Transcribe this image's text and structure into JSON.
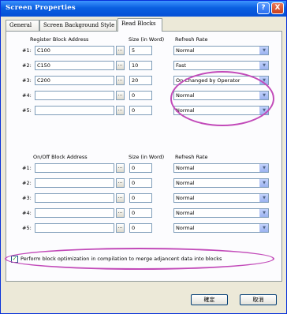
{
  "window": {
    "title": "Screen Properties",
    "help_label": "?",
    "close_label": "X"
  },
  "tabs": [
    {
      "label": "General"
    },
    {
      "label": "Screen Background Style"
    },
    {
      "label": "Read Blocks"
    }
  ],
  "register": {
    "header_address": "Register Block Address",
    "header_size": "Size (in Word)",
    "header_rate": "Refresh Rate",
    "rows": [
      {
        "label": "#1:",
        "address": "C100",
        "size": "5",
        "rate": "Normal"
      },
      {
        "label": "#2:",
        "address": "C150",
        "size": "10",
        "rate": "Fast"
      },
      {
        "label": "#3:",
        "address": "C200",
        "size": "20",
        "rate": "On Changed by Operator"
      },
      {
        "label": "#4:",
        "address": "",
        "size": "0",
        "rate": "Normal"
      },
      {
        "label": "#5:",
        "address": "",
        "size": "0",
        "rate": "Normal"
      }
    ]
  },
  "onoff": {
    "header_address": "On/Off Block Address",
    "header_size": "Size (in Word)",
    "header_rate": "Refresh Rate",
    "rows": [
      {
        "label": "#1:",
        "address": "",
        "size": "0",
        "rate": "Normal"
      },
      {
        "label": "#2:",
        "address": "",
        "size": "0",
        "rate": "Normal"
      },
      {
        "label": "#3:",
        "address": "",
        "size": "0",
        "rate": "Normal"
      },
      {
        "label": "#4:",
        "address": "",
        "size": "0",
        "rate": "Normal"
      },
      {
        "label": "#5:",
        "address": "",
        "size": "0",
        "rate": "Normal"
      }
    ]
  },
  "browse_label": "...",
  "optimization": {
    "checked": true,
    "label": "Perform block optimization in compilation to merge adjancent data into blocks"
  },
  "buttons": {
    "ok": "確定",
    "cancel": "取消"
  },
  "colors": {
    "title_bar": "#0a5fe0",
    "highlight_ellipse": "#c24ab9",
    "panel": "#fcfcfe",
    "dialog": "#ece9d8"
  }
}
